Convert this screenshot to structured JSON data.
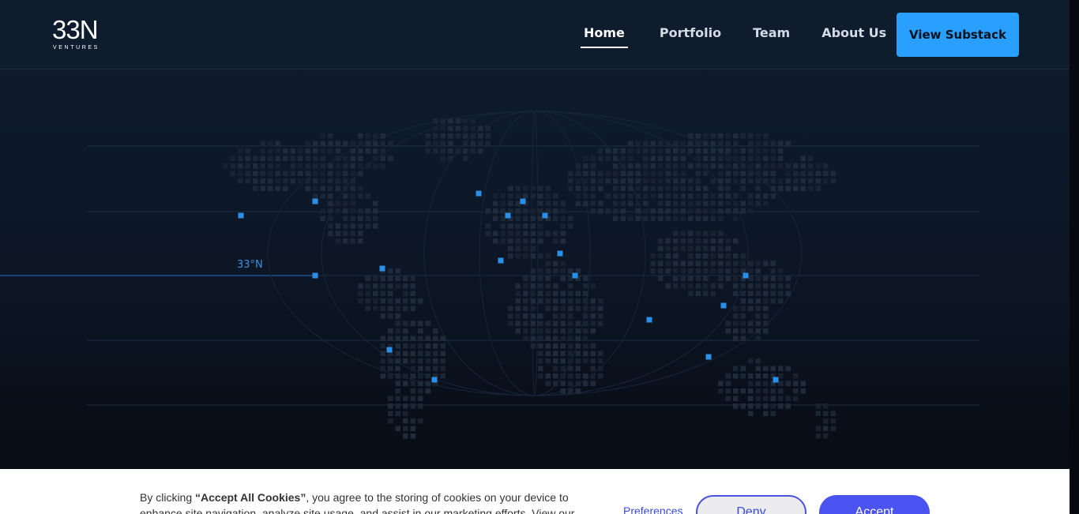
{
  "brand": {
    "logo_mark": "33",
    "logo_mark_n": "N",
    "logo_sub": "VENTURES",
    "logo_icon": "33n-ventures-logo-icon"
  },
  "nav": {
    "items": [
      {
        "label": "Home",
        "active": true
      },
      {
        "label": "Portfolio",
        "active": false
      },
      {
        "label": "Team",
        "active": false
      },
      {
        "label": "About Us",
        "active": false
      }
    ],
    "cta_label": "View Substack"
  },
  "hero": {
    "latitude_label": "33°N",
    "map_icon": "world-dot-map-icon"
  },
  "cookie": {
    "text_prefix": "By clicking ",
    "text_bold": "“Accept All Cookies”",
    "text_suffix": ", you agree to the storing of cookies on your device to enhance site navigation, analyze site usage, and assist in our marketing efforts. View our",
    "preferences_label": "Preferences",
    "deny_label": "Deny",
    "accept_label": "Accept"
  },
  "colors": {
    "accent": "#29a0ff",
    "header_bg": "#0f1c2e",
    "cookie_accent": "#4a52f0",
    "map_highlight": "#2a8fe8"
  }
}
